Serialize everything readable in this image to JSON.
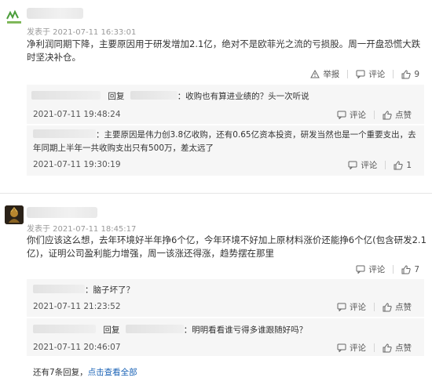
{
  "post1": {
    "meta": "发表于 2021-07-11 16:33:01",
    "content": "净利润同期下降，主要原因用于研发增加2.1亿，绝对不是欧菲光之流的亏损股。周一开盘恐慌大跌时坚决补仓。",
    "report_label": "举报",
    "comment_label": "评论",
    "like_count": "9",
    "replies": [
      {
        "reply_label": "回复",
        "text": "：收购也有算进业绩的？头一次听说",
        "date": "2021-07-11 19:48:24",
        "comment_label": "评论",
        "like_label": "点赞"
      },
      {
        "text": "：主要原因是伟力创3.8亿收购，还有0.65亿资本投资，研发当然也是一个重要支出，去年同期上半年一共收购支出只有500万，差太远了",
        "date": "2021-07-11 19:30:19",
        "comment_label": "评论",
        "like_count": "1"
      }
    ]
  },
  "post2": {
    "meta": "发表于 2021-07-11 18:45:17",
    "content": "你们应该这么想，去年环境好半年挣6个亿，今年环境不好加上原材料涨价还能挣6个亿(包含研发2.1亿)，证明公司盈利能力增强，周一该涨还得涨，趋势摆在那里",
    "comment_label": "评论",
    "like_count": "7",
    "replies": [
      {
        "text": "：脑子坏了？",
        "date": "2021-07-11 21:23:52",
        "comment_label": "评论",
        "like_label": "点赞"
      },
      {
        "reply_label": "回复",
        "text": "：明明看看谁亏得多谁跟随好吗？",
        "date": "2021-07-11 20:46:07",
        "comment_label": "评论",
        "like_label": "点赞"
      }
    ],
    "more_prefix": "还有7条回复，",
    "more_link": "点击查看全部"
  },
  "icons": [
    "avatar-logo-icon",
    "avatar-game-icon",
    "report-icon",
    "comment-icon",
    "thumbs-up-icon"
  ]
}
